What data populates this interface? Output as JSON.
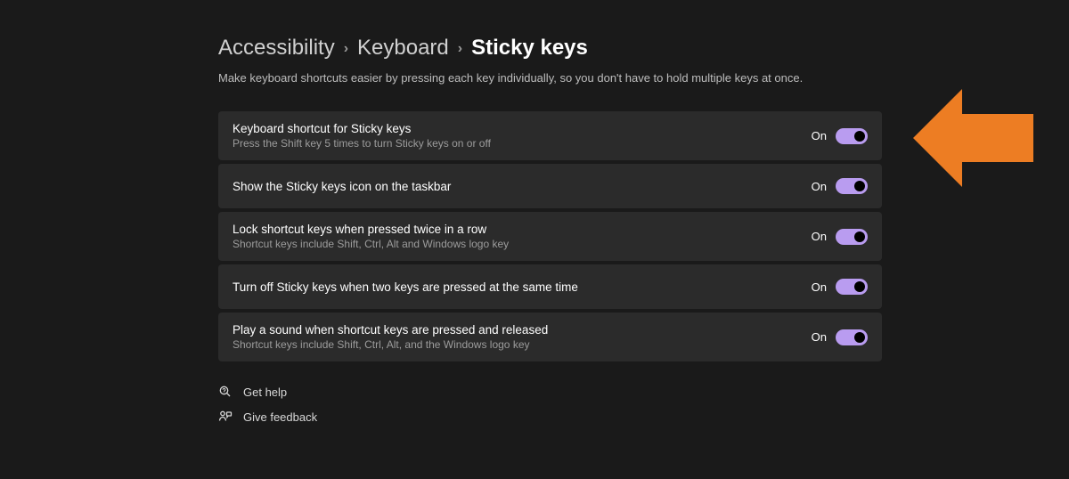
{
  "breadcrumb": {
    "items": [
      "Accessibility",
      "Keyboard"
    ],
    "current": "Sticky keys",
    "separator": "›"
  },
  "description": "Make keyboard shortcuts easier by pressing each key individually, so you don't have to hold multiple keys at once.",
  "settings": [
    {
      "title": "Keyboard shortcut for Sticky keys",
      "sub": "Press the Shift key 5 times to turn Sticky keys on or off",
      "state": "On"
    },
    {
      "title": "Show the Sticky keys icon on the taskbar",
      "sub": "",
      "state": "On"
    },
    {
      "title": "Lock shortcut keys when pressed twice in a row",
      "sub": "Shortcut keys include Shift, Ctrl, Alt and Windows logo key",
      "state": "On"
    },
    {
      "title": "Turn off Sticky keys when two keys are pressed at the same time",
      "sub": "",
      "state": "On"
    },
    {
      "title": "Play a sound when shortcut keys are pressed and released",
      "sub": "Shortcut keys include Shift, Ctrl, Alt, and the Windows logo key",
      "state": "On"
    }
  ],
  "footer": {
    "help": "Get help",
    "feedback": "Give feedback"
  }
}
